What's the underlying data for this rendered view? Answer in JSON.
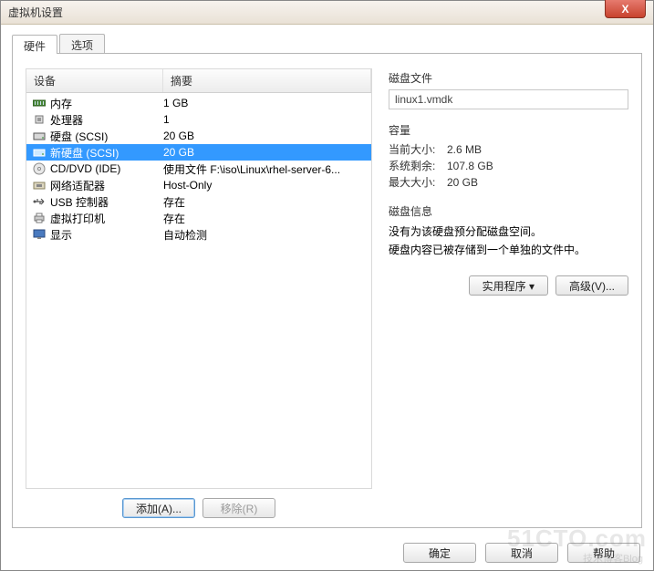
{
  "window": {
    "title": "虚拟机设置",
    "close_symbol": "X"
  },
  "tabs": {
    "hardware": "硬件",
    "options": "选项",
    "active": "hardware"
  },
  "device_table": {
    "header_device": "设备",
    "header_summary": "摘要",
    "selected_index": 3,
    "rows": [
      {
        "icon": "memory",
        "name": "内存",
        "summary": "1 GB"
      },
      {
        "icon": "cpu",
        "name": "处理器",
        "summary": "1"
      },
      {
        "icon": "disk",
        "name": "硬盘 (SCSI)",
        "summary": "20 GB"
      },
      {
        "icon": "disk",
        "name": "新硬盘 (SCSI)",
        "summary": "20 GB"
      },
      {
        "icon": "cd",
        "name": "CD/DVD (IDE)",
        "summary": "使用文件 F:\\iso\\Linux\\rhel-server-6..."
      },
      {
        "icon": "nic",
        "name": "网络适配器",
        "summary": "Host-Only"
      },
      {
        "icon": "usb",
        "name": "USB 控制器",
        "summary": "存在"
      },
      {
        "icon": "printer",
        "name": "虚拟打印机",
        "summary": "存在"
      },
      {
        "icon": "display",
        "name": "显示",
        "summary": "自动检测"
      }
    ]
  },
  "buttons": {
    "add": "添加(A)...",
    "remove": "移除(R)",
    "utilities": "实用程序 ▾",
    "advanced": "高级(V)...",
    "ok": "确定",
    "cancel": "取消",
    "help": "帮助"
  },
  "detail": {
    "file_section": "磁盘文件",
    "file_name": "linux1.vmdk",
    "capacity_section": "容量",
    "current_label": "当前大小:",
    "current_value": "2.6 MB",
    "free_label": "系统剩余:",
    "free_value": "107.8 GB",
    "max_label": "最大大小:",
    "max_value": "20 GB",
    "info_section": "磁盘信息",
    "info_line1": "没有为该硬盘预分配磁盘空间。",
    "info_line2": "硬盘内容已被存储到一个单独的文件中。"
  },
  "watermark": {
    "big": "51CTO.com",
    "small": "技术博客Blog"
  }
}
